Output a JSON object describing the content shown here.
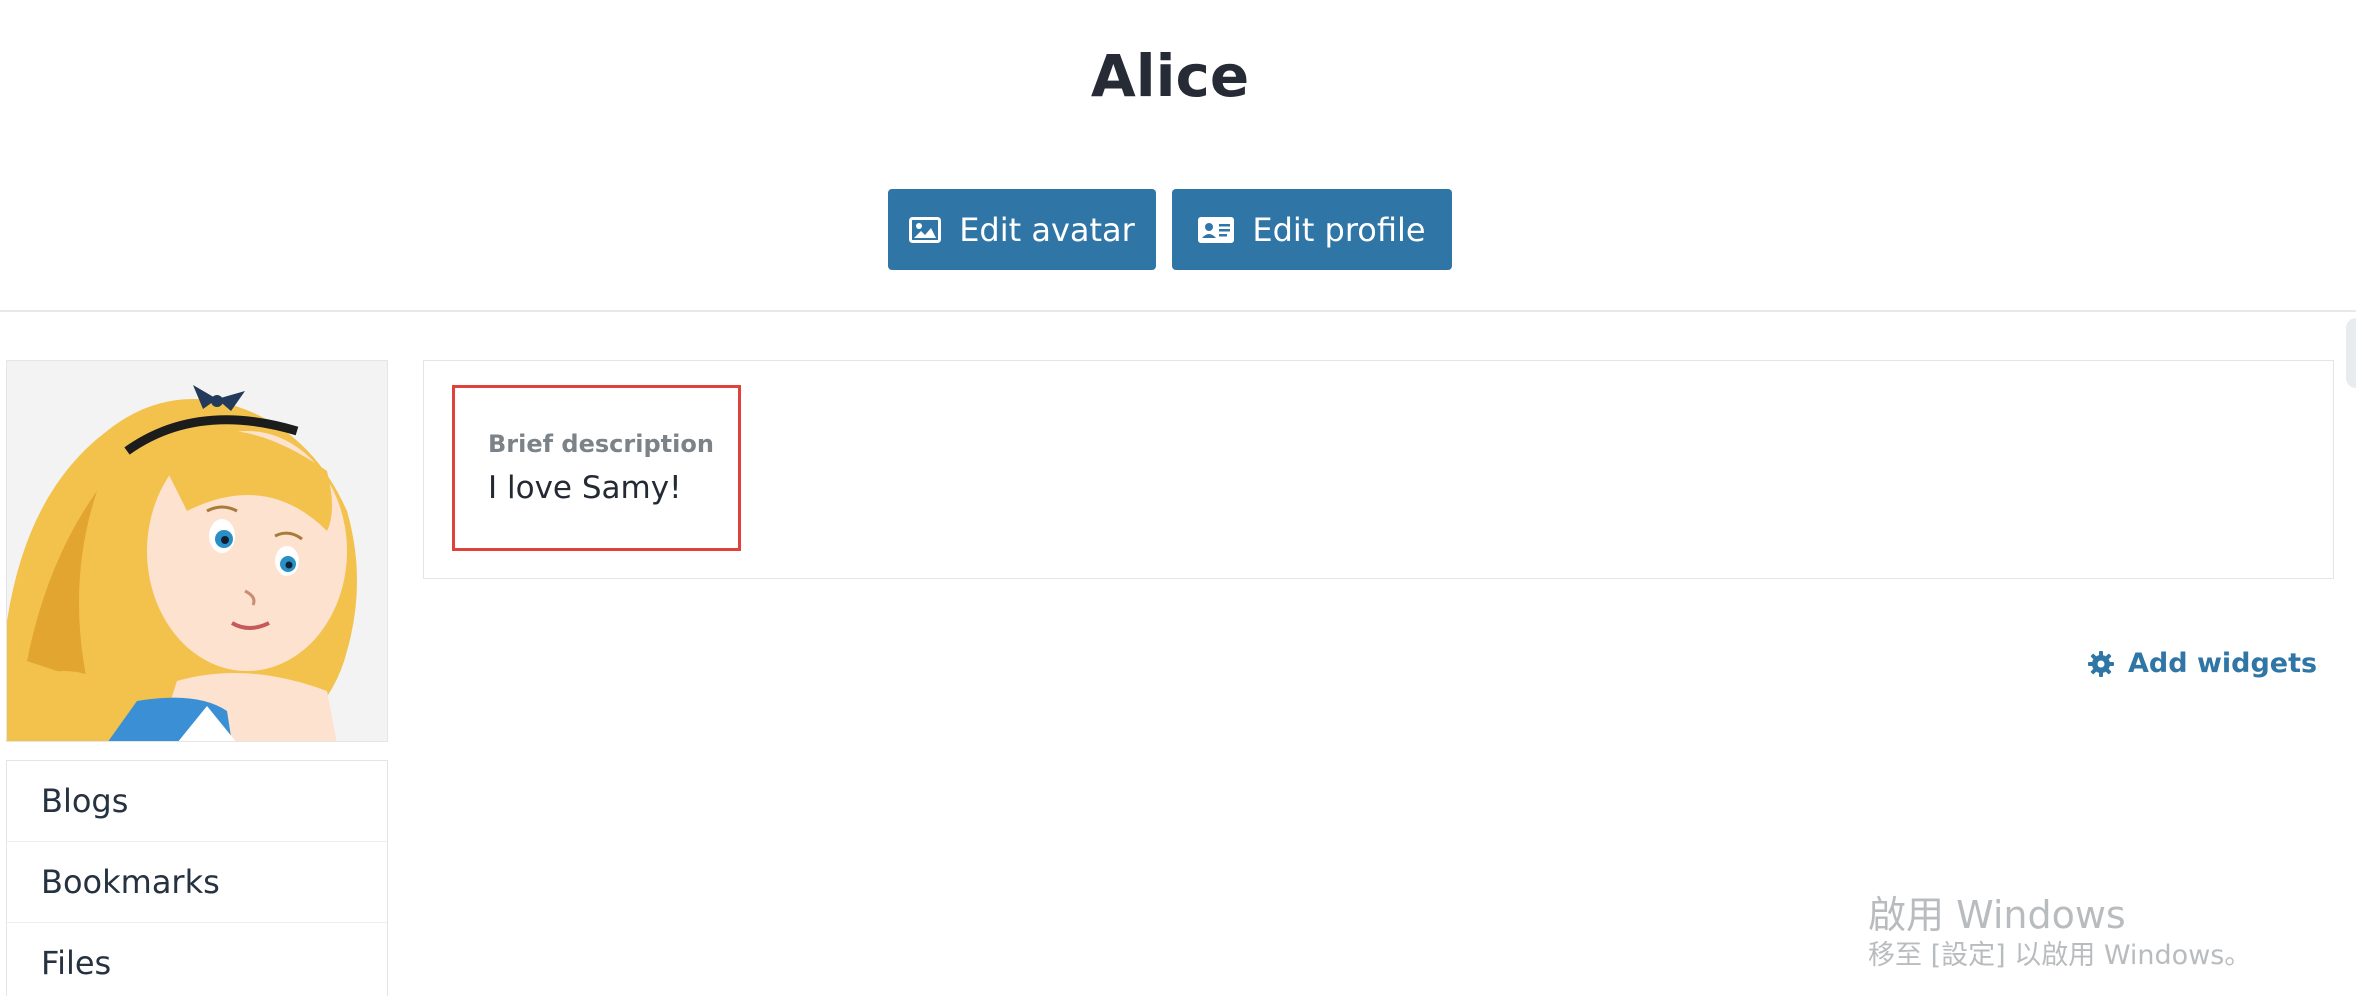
{
  "profile": {
    "name": "Alice",
    "edit_avatar_label": "Edit avatar",
    "edit_profile_label": "Edit profile"
  },
  "sidebar": {
    "items": [
      {
        "label": "Blogs"
      },
      {
        "label": "Bookmarks"
      },
      {
        "label": "Files"
      }
    ]
  },
  "widget": {
    "label": "Brief description",
    "text": "I love Samy!"
  },
  "add_widgets_label": "Add widgets",
  "watermark": {
    "line1": "啟用 Windows",
    "line2": "移至 [設定] 以啟用 Windows。"
  },
  "colors": {
    "accent": "#2f76a6",
    "highlight": "#e0413a"
  },
  "icons": {
    "edit_avatar": "image-icon",
    "edit_profile": "id-card-icon",
    "add_widgets": "gear-icon"
  }
}
